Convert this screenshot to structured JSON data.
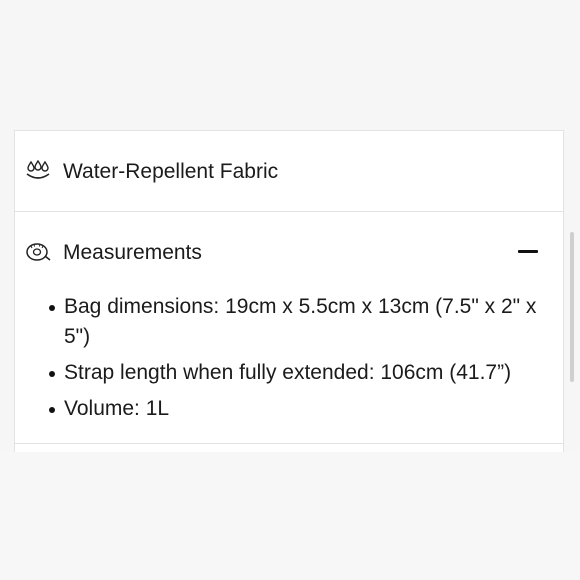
{
  "sections": {
    "water": {
      "title": "Water-Repellent Fabric",
      "icon": "water-drops-icon"
    },
    "measurements": {
      "title": "Measurements",
      "icon": "tape-measure-icon",
      "toggle_icon": "minus-icon",
      "expanded": true,
      "items": [
        "Bag dimensions: 19cm x 5.5cm x 13cm (7.5\" x 2\" x 5\")",
        "Strap length when fully extended: 106cm (41.7”)",
        "Volume: 1L"
      ]
    }
  }
}
